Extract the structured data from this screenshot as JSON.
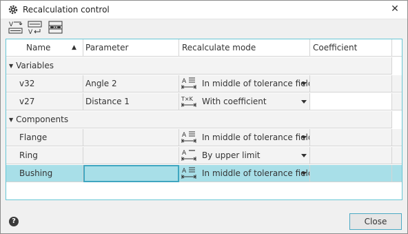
{
  "window": {
    "title": "Recalculation control",
    "close_glyph": "✕"
  },
  "toolbar": {
    "buttons": [
      {
        "icon": "variables-recalc-icon"
      },
      {
        "icon": "parameters-recalc-icon"
      },
      {
        "icon": "components-recalc-icon"
      }
    ]
  },
  "table": {
    "headers": {
      "name": "Name",
      "parameter": "Parameter",
      "mode": "Recalculate mode",
      "coefficient": "Coefficient"
    },
    "sort_glyph": "▲",
    "group_glyph": "▼",
    "groups": [
      {
        "label": "Variables",
        "rows": [
          {
            "name": "v32",
            "parameter": "Angle 2",
            "mode": "In middle of tolerance field",
            "mode_icon": "tolerance-middle-icon",
            "coefficient": ""
          },
          {
            "name": "v27",
            "parameter": "Distance 1",
            "mode": "With coefficient",
            "mode_icon": "tolerance-coefficient-icon",
            "coefficient": ""
          }
        ]
      },
      {
        "label": "Components",
        "rows": [
          {
            "name": "Flange",
            "parameter": "",
            "mode": "In middle of tolerance field",
            "mode_icon": "tolerance-middle-icon",
            "coefficient": ""
          },
          {
            "name": "Ring",
            "parameter": "",
            "mode": "By upper limit",
            "mode_icon": "tolerance-upper-icon",
            "coefficient": ""
          },
          {
            "name": "Bushing",
            "parameter": "",
            "mode": "In middle of tolerance field",
            "mode_icon": "tolerance-middle-icon",
            "coefficient": "",
            "selected": true
          }
        ]
      }
    ]
  },
  "footer": {
    "help_glyph": "?",
    "close_label": "Close"
  },
  "colors": {
    "selection": "#a8dfe8",
    "accent": "#4aa9c4"
  }
}
